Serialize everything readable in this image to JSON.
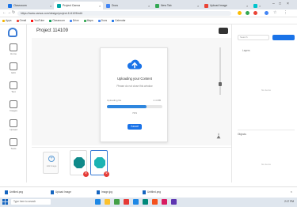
{
  "browser": {
    "tabs": [
      {
        "label": "Classroom"
      },
      {
        "label": "Project Canva"
      },
      {
        "label": "Docs"
      },
      {
        "label": "New Tab"
      },
      {
        "label": "Upload Image"
      },
      {
        "label": "Canva"
      }
    ],
    "url": "https://www.canva.com/design/project-114109/edit",
    "bookmarks": [
      "Apps",
      "Gmail",
      "YouTube",
      "Classroom",
      "Drive",
      "Maps",
      "Docs",
      "Calendar"
    ],
    "active_tab_index": 1
  },
  "app": {
    "rail_items": [
      {
        "label": "Home",
        "icon": "home-icon"
      },
      {
        "label": "Edit",
        "icon": "edit-icon"
      },
      {
        "label": "Text",
        "icon": "text-icon"
      },
      {
        "label": "Images",
        "icon": "image-icon"
      },
      {
        "label": "Upload",
        "icon": "upload-icon"
      },
      {
        "label": "Tools",
        "icon": "tools-icon"
      }
    ],
    "project_title": "Project 114109",
    "accent_color": "#1a73e8"
  },
  "upload_dialog": {
    "title": "Uploading your Content",
    "subtitle": "Please do not close this window",
    "file_label": "Uploading file",
    "file_size": "2.4 MB",
    "progress_percent": 72,
    "progress_text": "72%",
    "cancel_label": "Cancel"
  },
  "thumbnails": {
    "add_label": "Add Image",
    "items": [
      {
        "name": "teal-octagon",
        "color": "#0f8a8a",
        "selected": false
      },
      {
        "name": "cyan-octagon",
        "color": "#1bb3b3",
        "selected": true
      }
    ]
  },
  "right_panel": {
    "search_placeholder": "Search",
    "section_label": "Layers",
    "empty_text": "No items",
    "section2_label": "Objects",
    "empty2_text": "No items"
  },
  "downloads": [
    {
      "label": "Untitled.png"
    },
    {
      "label": "Upload Image"
    },
    {
      "label": "Image.jpg"
    },
    {
      "label": "Untitled.png"
    }
  ],
  "taskbar": {
    "search_placeholder": "Type here to search",
    "tray_text": "2:17 PM"
  }
}
